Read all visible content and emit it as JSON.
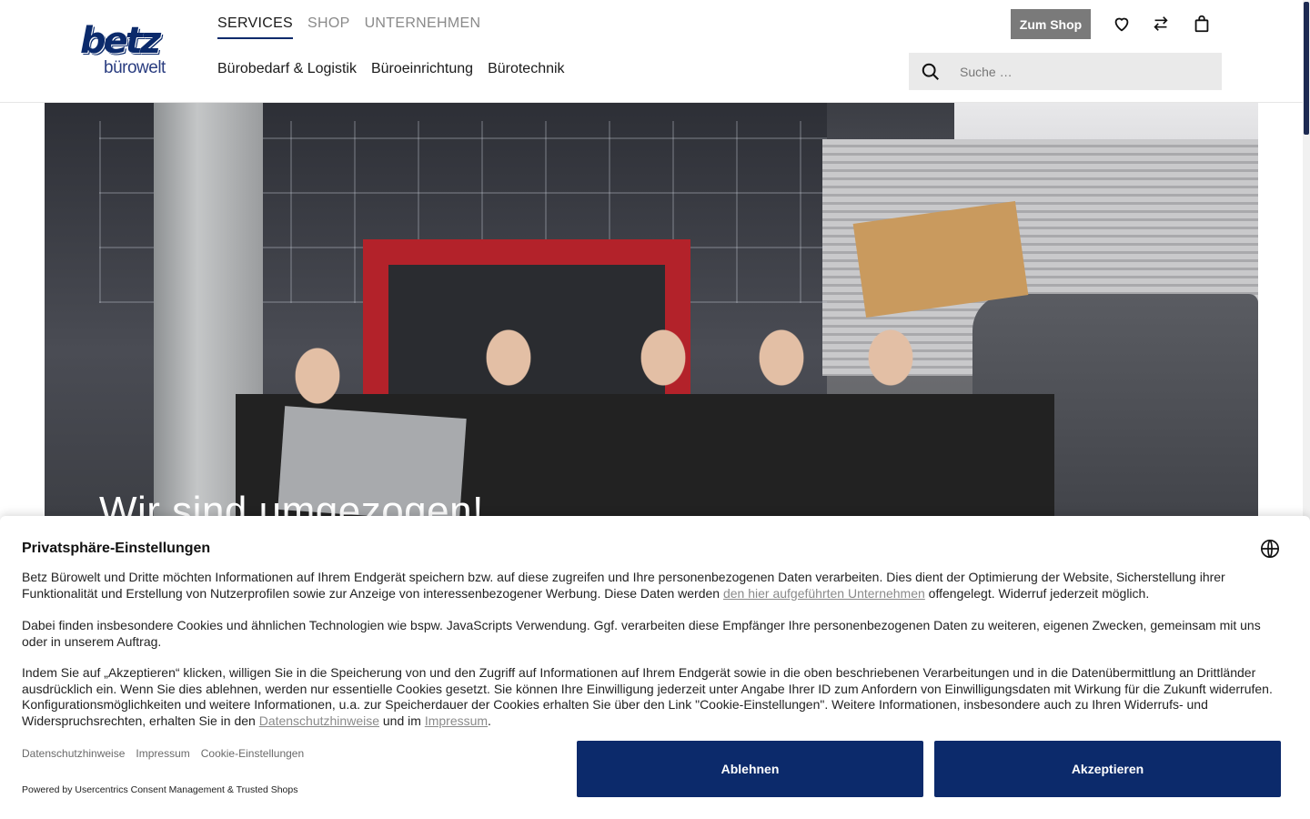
{
  "brand": {
    "logo_main": "betz",
    "logo_sub": "bürowelt",
    "primary_color": "#0c2a6b"
  },
  "header": {
    "top_nav": [
      {
        "label": "SERVICES",
        "active": true
      },
      {
        "label": "SHOP",
        "active": false
      },
      {
        "label": "UNTERNEHMEN",
        "active": false
      }
    ],
    "sub_nav": [
      {
        "label": "Bürobedarf & Logistik"
      },
      {
        "label": "Büroeinrichtung"
      },
      {
        "label": "Bürotechnik"
      }
    ],
    "shop_button": "Zum Shop",
    "icons": [
      "heart-icon",
      "compare-icon",
      "bag-icon"
    ],
    "search": {
      "placeholder": "Suche …"
    }
  },
  "hero": {
    "caption": "Wir sind umgezogen!"
  },
  "consent": {
    "title": "Privatsphäre-Einstellungen",
    "p1_a": "Betz Bürowelt und Dritte möchten Informationen auf Ihrem Endgerät speichern bzw. auf diese zugreifen und Ihre personenbezogenen Daten verarbeiten. Dies dient der Optimierung der Website, Sicherstellung ihrer Funktionalität und Erstellung von Nutzerprofilen sowie zur Anzeige von interessenbezogener Werbung. Diese Daten werden ",
    "p1_link": "den hier aufgeführten Unternehmen",
    "p1_b": " offengelegt. Widerruf jederzeit möglich.",
    "p2": "Dabei finden insbesondere Cookies und ähnlichen Technologien wie bspw. JavaScripts Verwendung. Ggf. verarbeiten diese Empfänger Ihre personenbezogenen Daten zu weiteren, eigenen Zwecken, gemeinsam mit uns oder in unserem Auftrag.",
    "p3_a": "Indem Sie auf „Akzeptieren“ klicken, willigen Sie in die Speicherung von und den Zugriff auf Informationen auf Ihrem Endgerät sowie in die oben beschriebenen Verarbeitungen und in die Datenübermittlung an Drittländer ausdrücklich ein. Wenn Sie dies ablehnen, werden nur essentielle Cookies gesetzt. Sie können Ihre Einwilligung jederzeit unter Angabe Ihrer ID zum Anfordern von Einwilligungsdaten mit Wirkung für die Zukunft widerrufen. Konfigurationsmöglichkeiten und weitere Informationen, u.a. zur Speicherdauer der Cookies erhalten Sie über den Link \"Cookie-Einstellungen\". Weitere Informationen, insbesondere auch zu Ihren Widerrufs- und Widerspruchsrechten, erhalten Sie in den ",
    "p3_link1": "Datenschutzhinweise",
    "p3_mid": " und im ",
    "p3_link2": "Impressum",
    "p3_end": ".",
    "footer_links": [
      "Datenschutzhinweise",
      "Impressum",
      "Cookie-Einstellungen"
    ],
    "powered_by": "Powered by Usercentrics Consent Management & Trusted Shops",
    "decline_label": "Ablehnen",
    "accept_label": "Akzeptieren"
  }
}
